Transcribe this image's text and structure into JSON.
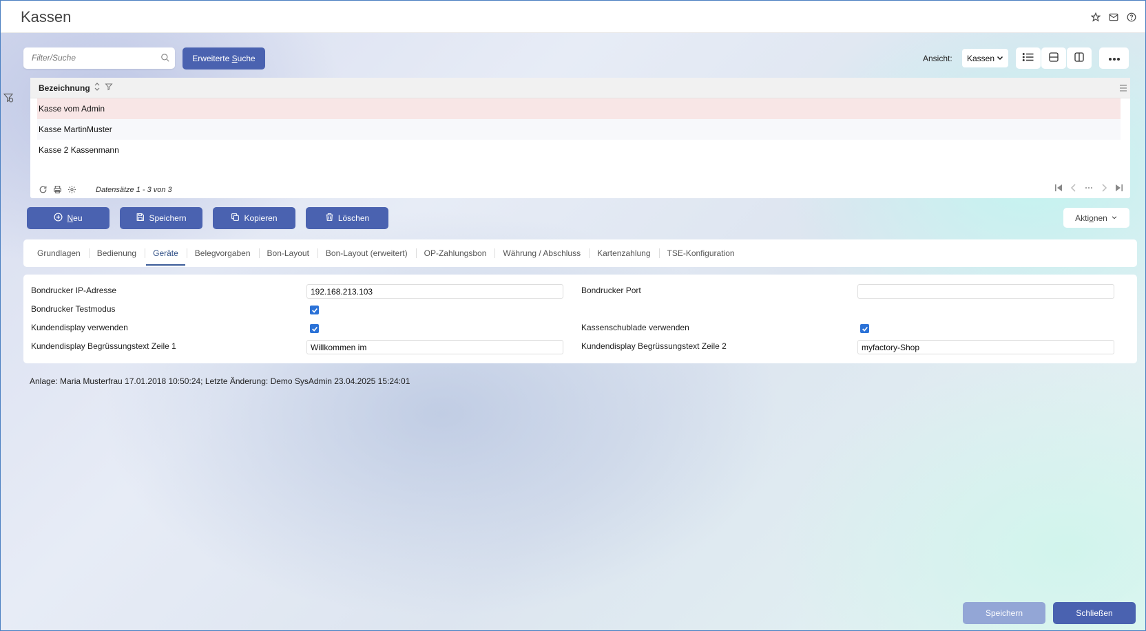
{
  "window": {
    "title": "Kassen"
  },
  "search": {
    "placeholder": "Filter/Suche",
    "advanced_label_prefix": "Erweiterte ",
    "advanced_label_underlined": "S",
    "advanced_label_suffix": "uche"
  },
  "view": {
    "label": "Ansicht:",
    "selected": "Kassen"
  },
  "grid": {
    "column_header": "Bezeichnung",
    "rows": [
      "Kasse vom Admin",
      "Kasse MartinMuster",
      "Kasse 2 Kassenmann"
    ],
    "footer_count": "Datensätze 1 - 3 von 3"
  },
  "actions": {
    "new_underlined": "N",
    "new_rest": "eu",
    "save": "Speichern",
    "copy": "Kopieren",
    "delete": "Löschen",
    "more_prefix": "Akti",
    "more_underlined": "o",
    "more_suffix": "nen"
  },
  "tabs": [
    "Grundlagen",
    "Bedienung",
    "Geräte",
    "Belegvorgaben",
    "Bon-Layout",
    "Bon-Layout (erweitert)",
    "OP-Zahlungsbon",
    "Währung / Abschluss",
    "Kartenzahlung",
    "TSE-Konfiguration"
  ],
  "active_tab": "Geräte",
  "form": {
    "printer_ip_label": "Bondrucker IP-Adresse",
    "printer_ip_value": "192.168.213.103",
    "printer_port_label": "Bondrucker Port",
    "printer_port_value": "",
    "printer_test_label": "Bondrucker Testmodus",
    "printer_test_checked": true,
    "display_use_label": "Kundendisplay verwenden",
    "display_use_checked": true,
    "drawer_label": "Kassenschublade verwenden",
    "drawer_checked": true,
    "greeting1_label": "Kundendisplay Begrüssungstext Zeile 1",
    "greeting1_value": "Willkommen im",
    "greeting2_label": "Kundendisplay Begrüssungstext Zeile 2",
    "greeting2_value": "myfactory-Shop"
  },
  "meta": "Anlage: Maria Musterfrau 17.01.2018 10:50:24; Letzte Änderung: Demo SysAdmin 23.04.2025 15:24:01",
  "footer": {
    "save": "Speichern",
    "close": "Schließen"
  },
  "colors": {
    "primary": "#4a62b0",
    "primary_disabled": "#93a6d6",
    "selected_row": "#f8e6e6",
    "checkbox": "#2b72d7"
  }
}
